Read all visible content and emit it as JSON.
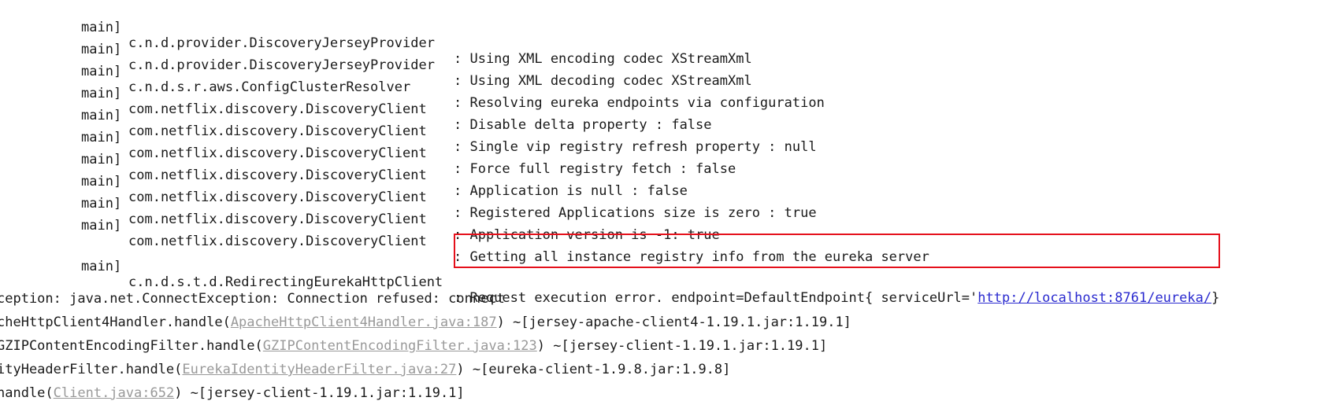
{
  "logs": [
    {
      "thread": "main]",
      "logger": "c.n.d.provider.DiscoveryJerseyProvider",
      "message": ": Using XML encoding codec XStreamXml"
    },
    {
      "thread": "main]",
      "logger": "c.n.d.provider.DiscoveryJerseyProvider",
      "message": ": Using XML decoding codec XStreamXml"
    },
    {
      "thread": "main]",
      "logger": "c.n.d.s.r.aws.ConfigClusterResolver",
      "message": ": Resolving eureka endpoints via configuration"
    },
    {
      "thread": "main]",
      "logger": "com.netflix.discovery.DiscoveryClient",
      "message": ": Disable delta property : false"
    },
    {
      "thread": "main]",
      "logger": "com.netflix.discovery.DiscoveryClient",
      "message": ": Single vip registry refresh property : null"
    },
    {
      "thread": "main]",
      "logger": "com.netflix.discovery.DiscoveryClient",
      "message": ": Force full registry fetch : false"
    },
    {
      "thread": "main]",
      "logger": "com.netflix.discovery.DiscoveryClient",
      "message": ": Application is null : false"
    },
    {
      "thread": "main]",
      "logger": "com.netflix.discovery.DiscoveryClient",
      "message": ": Registered Applications size is zero : true"
    },
    {
      "thread": "main]",
      "logger": "com.netflix.discovery.DiscoveryClient",
      "message": ": Application version is -1: true"
    },
    {
      "thread": "main]",
      "logger": "com.netflix.discovery.DiscoveryClient",
      "message": ": Getting all instance registry info from the eureka server"
    }
  ],
  "error_line": {
    "thread": "main]",
    "logger": "c.n.d.s.t.d.RedirectingEurekaHttpClient",
    "message_prefix": ": Request execution error. endpoint=DefaultEndpoint{ serviceUrl='",
    "url": "http://localhost:8761/eureka/",
    "message_suffix": "}"
  },
  "exception_line": "ception: java.net.ConnectException: Connection refused: connect",
  "stack": [
    {
      "prefix": "cheHttpClient4Handler.handle(",
      "source": "ApacheHttpClient4Handler.java:187",
      "suffix": ") ~[jersey-apache-client4-1.19.1.jar:1.19.1]"
    },
    {
      "prefix": "GZIPContentEncodingFilter.handle(",
      "source": "GZIPContentEncodingFilter.java:123",
      "suffix": ") ~[jersey-client-1.19.1.jar:1.19.1]"
    },
    {
      "prefix": "ityHeaderFilter.handle(",
      "source": "EurekaIdentityHeaderFilter.java:27",
      "suffix": ") ~[eureka-client-1.9.8.jar:1.9.8]"
    },
    {
      "prefix": "handle(",
      "source": "Client.java:652",
      "suffix": ") ~[jersey-client-1.19.1.jar:1.19.1]"
    }
  ],
  "colors": {
    "highlight_border": "#e5101b",
    "link": "#2a2acf",
    "source_link": "#999999"
  }
}
